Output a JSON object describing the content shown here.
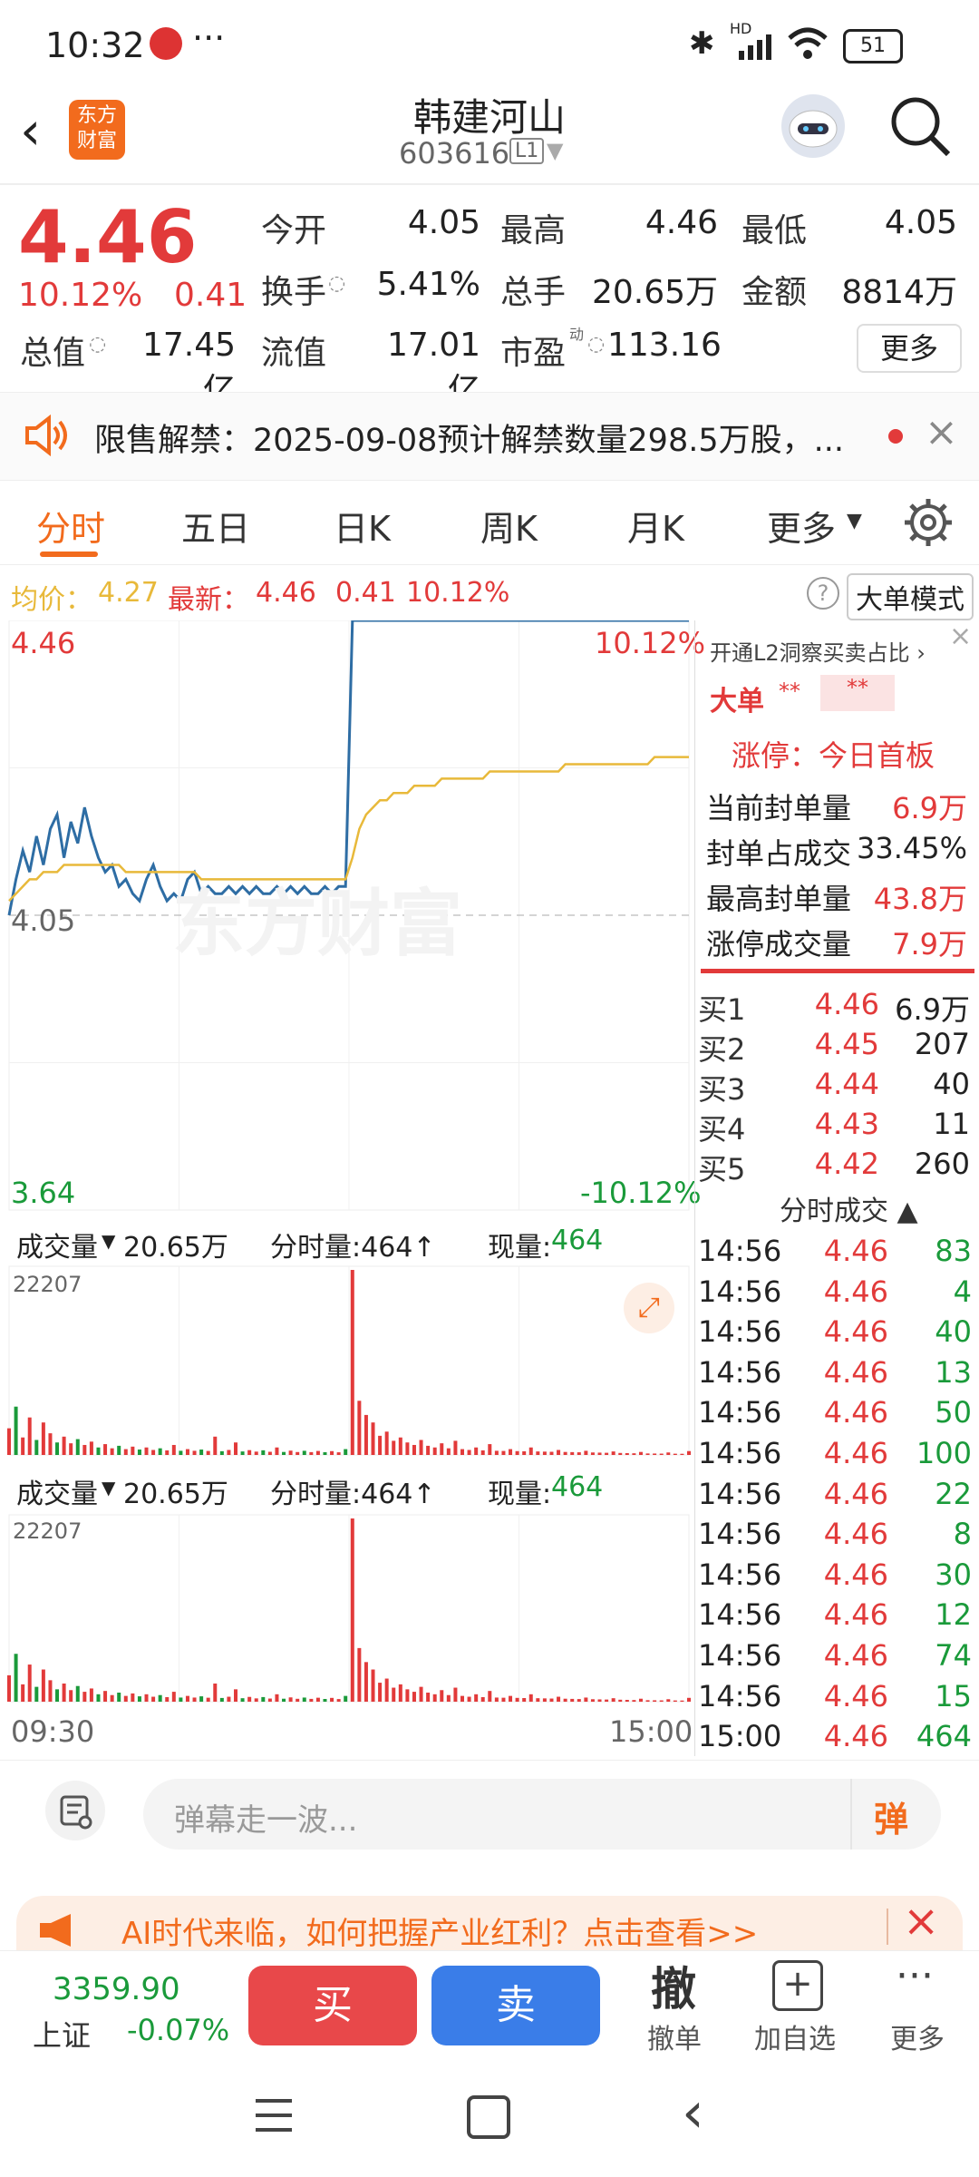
{
  "status_bar": {
    "time": "10:32",
    "battery": "51",
    "network": "HD"
  },
  "header": {
    "title": "韩建河山",
    "code": "603616",
    "level": "L1",
    "logo_text": "东方财富"
  },
  "quote": {
    "price": "4.46",
    "change_pct": "10.12%",
    "change": "0.41",
    "fields": [
      {
        "label": "今开",
        "value": "4.05",
        "color": "#222"
      },
      {
        "label": "最高",
        "value": "4.46",
        "color": "#e23a3a"
      },
      {
        "label": "最低",
        "value": "4.05",
        "color": "#222"
      },
      {
        "label": "换手",
        "value": "5.41%",
        "color": "#222"
      },
      {
        "label": "总手",
        "value": "20.65万",
        "color": "#222"
      },
      {
        "label": "金额",
        "value": "8814万",
        "color": "#222"
      },
      {
        "label": "总值",
        "value": "17.45亿",
        "color": "#222"
      },
      {
        "label": "流值",
        "value": "17.01亿",
        "color": "#222"
      },
      {
        "label": "市盈",
        "value": "113.16",
        "color": "#222"
      }
    ],
    "pe_superscript": "动",
    "more_button": "更多"
  },
  "notice": {
    "text": "限售解禁：2025-09-08预计解禁数量298.5万股，..."
  },
  "tabs": {
    "items": [
      "分时",
      "五日",
      "日K",
      "周K",
      "月K",
      "更多"
    ],
    "active": "分时"
  },
  "info_line": {
    "avg_label": "均价：",
    "avg": "4.27",
    "latest_label": "最新：",
    "latest": "4.46",
    "change": "0.41",
    "pct": "10.12%",
    "big_order_mode": "大单模式"
  },
  "chart_data": {
    "type": "line",
    "title": "",
    "x_start": "09:30",
    "x_end": "15:00",
    "y_top": "4.46",
    "y_ref": "4.05",
    "y_bottom": "3.64",
    "pct_top": "10.12%",
    "pct_bottom": "-10.12%",
    "ylim": [
      3.64,
      4.46
    ],
    "series": [
      {
        "values": [
          4.05,
          4.1,
          4.14,
          4.11,
          4.16,
          4.12,
          4.17,
          4.19,
          4.13,
          4.18,
          4.15,
          4.2,
          4.16,
          4.13,
          4.11,
          4.12,
          4.09,
          4.1,
          4.08,
          4.07,
          4.1,
          4.12,
          4.09,
          4.07,
          4.08,
          4.07,
          4.1,
          4.11,
          4.08,
          4.09,
          4.08,
          4.08,
          4.09,
          4.08,
          4.09,
          4.08,
          4.09,
          4.08,
          4.08,
          4.09,
          4.08,
          4.09,
          4.08,
          4.09,
          4.08,
          4.08,
          4.09,
          4.08,
          4.09,
          4.09,
          4.46,
          4.46,
          4.46,
          4.46,
          4.46,
          4.46,
          4.46,
          4.46,
          4.46,
          4.46,
          4.46,
          4.46,
          4.46,
          4.46,
          4.46,
          4.46,
          4.46,
          4.46,
          4.46,
          4.46,
          4.46,
          4.46,
          4.46,
          4.46,
          4.46,
          4.46,
          4.46,
          4.46,
          4.46,
          4.46,
          4.46,
          4.46,
          4.46,
          4.46,
          4.46,
          4.46,
          4.46,
          4.46,
          4.46,
          4.46,
          4.46,
          4.46,
          4.46,
          4.46,
          4.46,
          4.46,
          4.46,
          4.46,
          4.46,
          4.46
        ]
      },
      {
        "values": [
          4.07,
          4.08,
          4.09,
          4.1,
          4.1,
          4.11,
          4.11,
          4.11,
          4.12,
          4.12,
          4.12,
          4.12,
          4.12,
          4.12,
          4.12,
          4.12,
          4.12,
          4.11,
          4.11,
          4.11,
          4.11,
          4.11,
          4.11,
          4.11,
          4.11,
          4.11,
          4.11,
          4.11,
          4.1,
          4.1,
          4.1,
          4.1,
          4.1,
          4.1,
          4.1,
          4.1,
          4.1,
          4.1,
          4.1,
          4.1,
          4.1,
          4.1,
          4.1,
          4.1,
          4.1,
          4.1,
          4.1,
          4.1,
          4.1,
          4.1,
          4.13,
          4.17,
          4.19,
          4.2,
          4.21,
          4.21,
          4.22,
          4.22,
          4.22,
          4.23,
          4.23,
          4.23,
          4.23,
          4.24,
          4.24,
          4.24,
          4.24,
          4.24,
          4.24,
          4.24,
          4.25,
          4.25,
          4.25,
          4.25,
          4.25,
          4.25,
          4.25,
          4.25,
          4.25,
          4.25,
          4.25,
          4.26,
          4.26,
          4.26,
          4.26,
          4.26,
          4.26,
          4.26,
          4.26,
          4.26,
          4.26,
          4.26,
          4.26,
          4.26,
          4.27,
          4.27,
          4.27,
          4.27,
          4.27,
          4.27
        ]
      }
    ],
    "volume": {
      "max_label": "22207",
      "ylim": [
        0,
        22207
      ],
      "values": [
        3200,
        5800,
        2100,
        4500,
        1800,
        3900,
        2600,
        1500,
        2200,
        1400,
        1900,
        1200,
        1600,
        900,
        1300,
        800,
        1100,
        700,
        1000,
        650,
        900,
        600,
        800,
        550,
        1200,
        500,
        700,
        500,
        650,
        480,
        2200,
        450,
        600,
        1500,
        420,
        580,
        400,
        560,
        380,
        900,
        360,
        520,
        350,
        500,
        340,
        480,
        330,
        460,
        320,
        700,
        22207,
        6500,
        4800,
        3900,
        2300,
        2800,
        1700,
        2100,
        1500,
        1200,
        1800,
        1100,
        900,
        1400,
        800,
        1700,
        700,
        600,
        900,
        550,
        1300,
        500,
        480,
        700,
        460,
        440,
        900,
        420,
        400,
        380,
        600,
        360,
        340,
        320,
        500,
        300,
        280,
        260,
        420,
        240,
        220,
        200,
        360,
        180,
        170,
        160,
        300,
        150,
        140,
        464
      ]
    },
    "volume_bar": {
      "label": "成交量",
      "total": "20.65万",
      "minute_label": "分时量:464↑",
      "current_label": "现量:",
      "current": "464"
    }
  },
  "right_panel": {
    "l2_text": "开通L2洞察买卖占比 ›",
    "big_order_label": "大单",
    "big_order_masked": "**",
    "limit_up_title": "涨停：今日首板",
    "stats": [
      {
        "label": "当前封单量",
        "value": "6.9万",
        "color": "#e23a3a"
      },
      {
        "label": "封单占成交",
        "value": "33.45%",
        "color": "#222"
      },
      {
        "label": "最高封单量",
        "value": "43.8万",
        "color": "#e23a3a"
      },
      {
        "label": "涨停成交量",
        "value": "7.9万",
        "color": "#e23a3a"
      }
    ],
    "bids": [
      {
        "label": "买1",
        "price": "4.46",
        "vol": "6.9万"
      },
      {
        "label": "买2",
        "price": "4.45",
        "vol": "207"
      },
      {
        "label": "买3",
        "price": "4.44",
        "vol": "40"
      },
      {
        "label": "买4",
        "price": "4.43",
        "vol": "11"
      },
      {
        "label": "买5",
        "price": "4.42",
        "vol": "260"
      }
    ],
    "trades_title": "分时成交 ▲",
    "trades": [
      {
        "time": "14:56",
        "price": "4.46",
        "vol": "83"
      },
      {
        "time": "14:56",
        "price": "4.46",
        "vol": "4"
      },
      {
        "time": "14:56",
        "price": "4.46",
        "vol": "40"
      },
      {
        "time": "14:56",
        "price": "4.46",
        "vol": "13"
      },
      {
        "time": "14:56",
        "price": "4.46",
        "vol": "50"
      },
      {
        "time": "14:56",
        "price": "4.46",
        "vol": "100"
      },
      {
        "time": "14:56",
        "price": "4.46",
        "vol": "22"
      },
      {
        "time": "14:56",
        "price": "4.46",
        "vol": "8"
      },
      {
        "time": "14:56",
        "price": "4.46",
        "vol": "30"
      },
      {
        "time": "14:56",
        "price": "4.46",
        "vol": "12"
      },
      {
        "time": "14:56",
        "price": "4.46",
        "vol": "74"
      },
      {
        "time": "14:56",
        "price": "4.46",
        "vol": "15"
      },
      {
        "time": "15:00",
        "price": "4.46",
        "vol": "464"
      }
    ]
  },
  "comment": {
    "placeholder": "弹幕走一波...",
    "danmu_label": "弹"
  },
  "ad": {
    "text": "AI时代来临，如何把握产业红利？点击查看>>"
  },
  "bottom": {
    "index_value": "3359.90",
    "index_name": "上证",
    "index_change": "-0.07%",
    "buy": "买",
    "sell": "卖",
    "cancel_icon_text": "撤",
    "cancel": "撤单",
    "add_watch": "加自选",
    "more": "更多"
  },
  "colors": {
    "up": "#e23a3a",
    "down": "#1a9a3a",
    "price_line": "#2e6da4",
    "avg_line": "#e8b93a",
    "accent": "#f26b1d",
    "buy_btn": "#e8484a",
    "sell_btn": "#3a7de8"
  }
}
